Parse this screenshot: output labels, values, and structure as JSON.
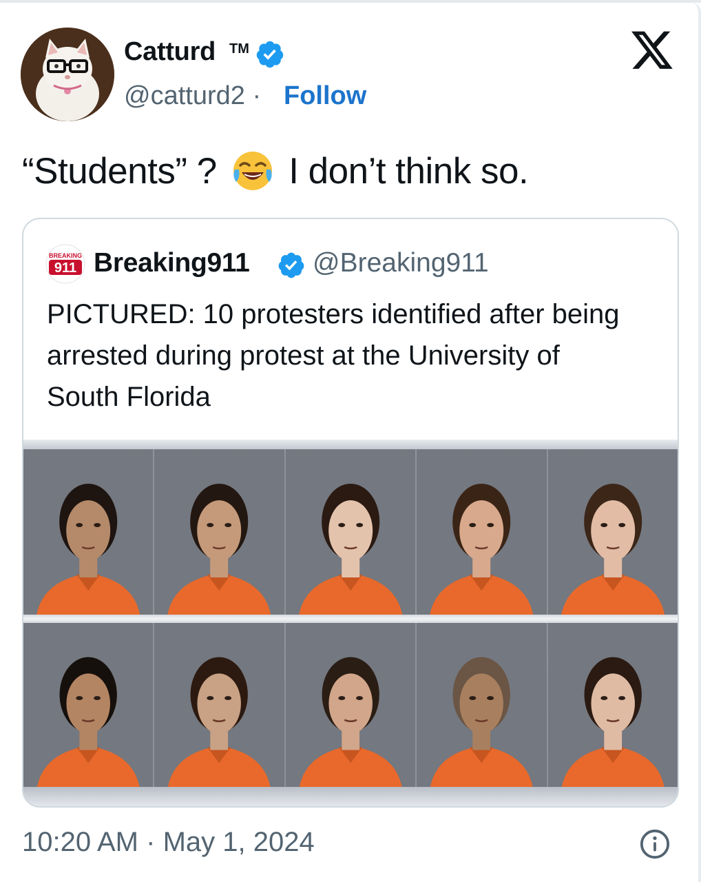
{
  "author": {
    "name": "Catturd",
    "tm": "TM",
    "handle": "@catturd2",
    "separator": "·",
    "follow_label": "Follow"
  },
  "tweet": {
    "text_before": "“Students” ?",
    "emoji": "face-with-tears-of-joy",
    "text_after": "I don’t think so."
  },
  "quoted": {
    "avatar_text": "911",
    "avatar_small_text": "BREAKING",
    "name": "Breaking911",
    "handle": "@Breaking911",
    "text": "PICTURED: 10 protesters identified after being arrested during protest at the University of South Florida",
    "photo_count": 10
  },
  "footer": {
    "time": "10:20 AM",
    "separator": "·",
    "date": "May 1, 2024"
  },
  "colors": {
    "accent": "#1d74cc",
    "verified": "#1d9bf0",
    "muted": "#536471",
    "jumpsuit": "#e8692b",
    "brand_red": "#c8102e"
  },
  "icons": [
    "x-logo-icon",
    "verified-badge-icon",
    "info-icon",
    "laughing-emoji-icon"
  ]
}
